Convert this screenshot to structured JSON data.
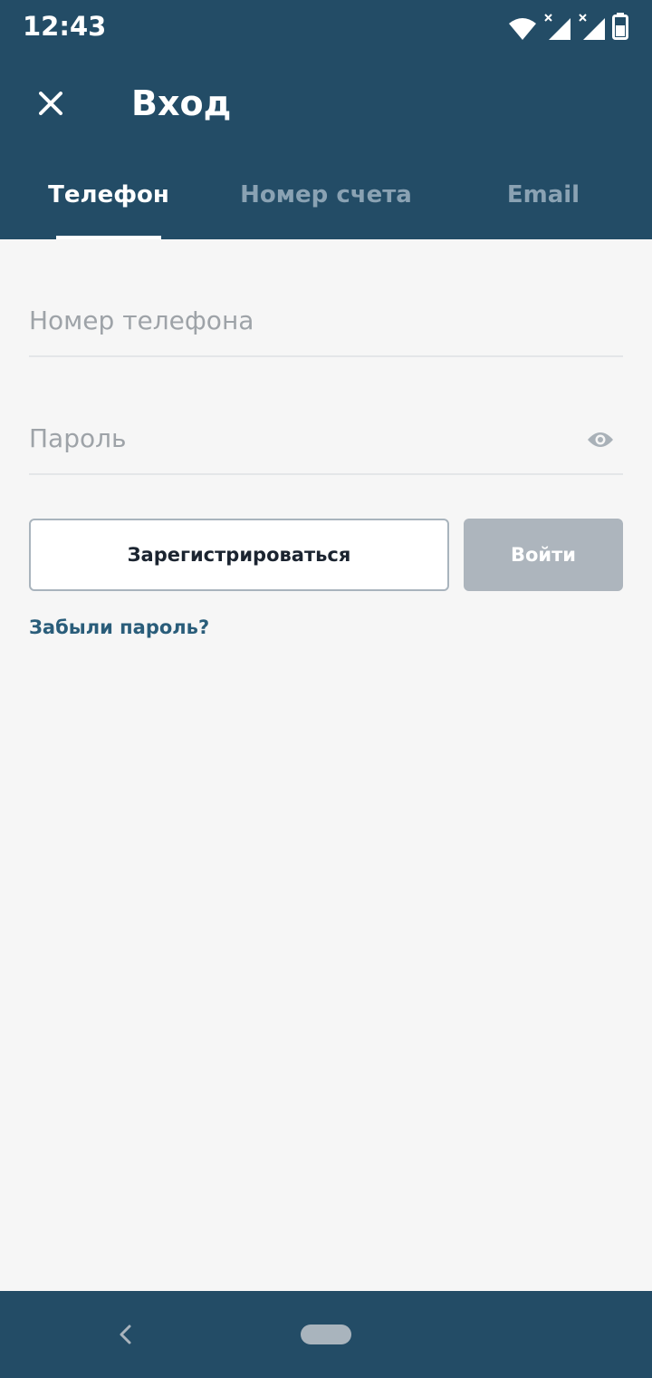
{
  "status_bar": {
    "time": "12:43",
    "icons": [
      "wifi-icon",
      "signal-icon-1",
      "signal-icon-2",
      "battery-icon"
    ]
  },
  "toolbar": {
    "close_icon": "close-icon",
    "title": "Вход"
  },
  "tabs": [
    {
      "label": "Телефон",
      "active": true
    },
    {
      "label": "Номер счета",
      "active": false
    },
    {
      "label": "Email",
      "active": false
    }
  ],
  "form": {
    "phone_placeholder": "Номер телефона",
    "phone_value": "",
    "password_placeholder": "Пароль",
    "password_value": "",
    "password_toggle_icon": "eye-icon",
    "register_label": "Зарегистрироваться",
    "login_label": "Войти",
    "forgot_label": "Забыли пароль?"
  },
  "nav": {
    "back_icon": "back-chevron-icon",
    "home_icon": "home-pill-icon"
  },
  "colors": {
    "primary": "#234c66",
    "background": "#f6f6f6",
    "tab_inactive": "#8aa2b3",
    "button_disabled": "#adb5bd",
    "link": "#2a5d7a"
  }
}
